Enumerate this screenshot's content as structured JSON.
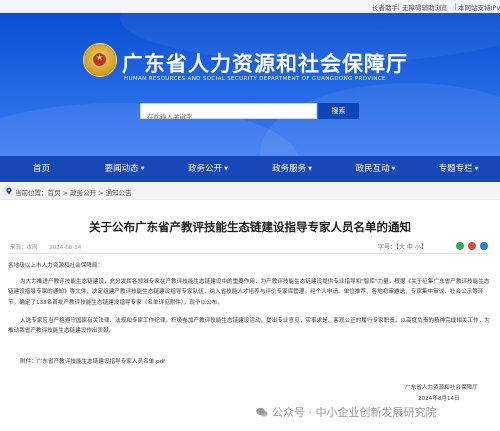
{
  "topbar": {
    "elder_assistant": "长者助手",
    "accessible": "无障碍辅助浏览",
    "ipv6": "本网站支持IPv6"
  },
  "header": {
    "title": "广东省人力资源和社会保障厅",
    "subtitle": "HUMAN RESOURCES AND SOCIAL SECURITY DEPARTMENT OF GUANGDONG PROVINCE"
  },
  "search": {
    "placeholder": "在此输入关键字",
    "button": "搜索"
  },
  "nav": {
    "items": [
      {
        "label": "首页"
      },
      {
        "label": "要闻动态"
      },
      {
        "label": "政务公开"
      },
      {
        "label": "政务服务"
      },
      {
        "label": "政民互动"
      },
      {
        "label": "专题专栏"
      }
    ]
  },
  "breadcrumb": {
    "text": "当前位置：首页 > 政务公开 > 通知公告"
  },
  "article": {
    "title": "关于公布广东省产教评技能生态链建设指导专家人员名单的通知",
    "source": "来源：本网",
    "date": "2024-08-14",
    "fontsize": "字号：【大 中 小】",
    "greeting": "各地级以上市人力资源和社会保障局：",
    "para1": "为大力推进产教评技能生态链建设，充分发挥各领域专家在产教评技能生态链建设中的重要作用，为产教评技能生态链建设提供专业指导和\"智库\"力量，根据《关于征集广东省产教评技能生态链建设指导专家的通知》等文件，决定组建产教评技能生态链建设指导专家队伍，纳入省技能人才培养与评价专家库管理。经个人申请、单位推荐、各地初审遴选、专家集中审议、社会公示等环节，确定了133名首批产教评技能生态链建设指导专家（名单详见附件），现予以公布。",
    "para2": "入选专家应当严格遵守国家有关法律、法规和专家工作纪律，积极参加产教评技能生态链建设活动，提出专业意见，实事求是、客观公正的履行专家职责，以高度负责的精神完成相关工作，为推动我省产教评技能生态链建设作出贡献。",
    "attachment": "附件：广东省产教评技能生态链建设指导专家人员名单.pdf",
    "signer": "广东省人力资源和社会保障厅",
    "sign_date": "2024年8月14日"
  },
  "watermark": {
    "text": "公众号 · 中小企业创新发展研究院"
  },
  "colors": {
    "banner": "#1f64e3",
    "nav": "#1848b8",
    "search_button": "#0b46b8"
  }
}
